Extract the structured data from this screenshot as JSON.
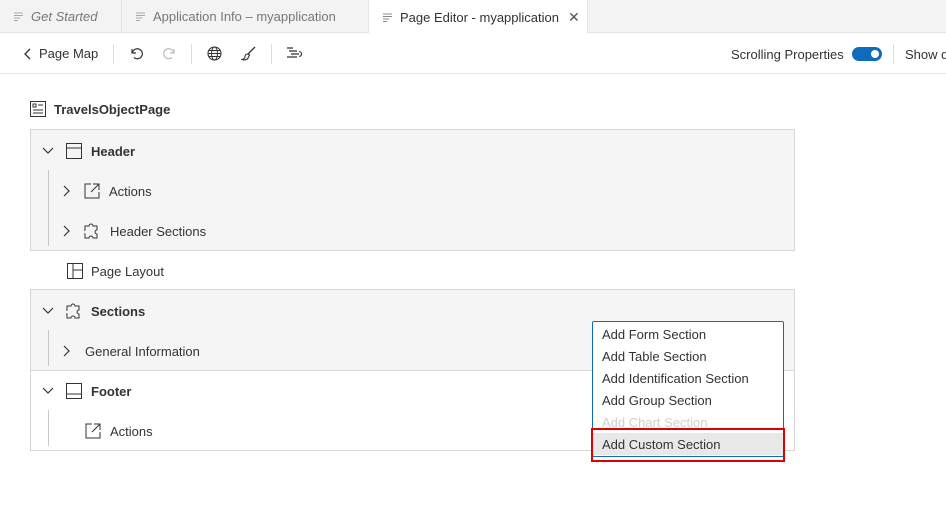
{
  "tabs": [
    {
      "label": "Get Started"
    },
    {
      "label": "Application Info – myapplication"
    },
    {
      "label": "Page Editor - myapplication"
    }
  ],
  "toolbar": {
    "page_map_label": "Page Map",
    "scrolling_label": "Scrolling Properties",
    "show_label": "Show d"
  },
  "tree": {
    "page_title": "TravelsObjectPage",
    "header": "Header",
    "header_actions": "Actions",
    "header_sections": "Header Sections",
    "page_layout": "Page Layout",
    "sections": "Sections",
    "general_information": "General Information",
    "footer": "Footer",
    "footer_actions": "Actions"
  },
  "menu": {
    "items": [
      {
        "label": "Add Form Section",
        "enabled": true
      },
      {
        "label": "Add Table Section",
        "enabled": true
      },
      {
        "label": "Add Identification Section",
        "enabled": true
      },
      {
        "label": "Add Group Section",
        "enabled": true
      },
      {
        "label": "Add Chart Section",
        "enabled": false
      },
      {
        "label": "Add Custom Section",
        "enabled": true
      }
    ]
  },
  "colors": {
    "accent": "#0f6cbd",
    "highlight": "#e00000"
  }
}
